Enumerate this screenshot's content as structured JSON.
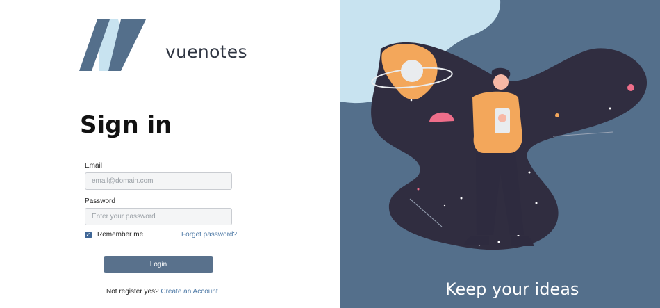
{
  "brand": {
    "name": "vuenotes",
    "logo_icon": "vuenotes-logo-icon"
  },
  "signin": {
    "title": "Sign in",
    "email_label": "Email",
    "email_placeholder": "email@domain.com",
    "email_value": "",
    "password_label": "Password",
    "password_placeholder": "Enter your password",
    "password_value": "",
    "remember_label": "Remember me",
    "remember_checked": true,
    "forgot_label": "Forget password?",
    "login_label": "Login",
    "register_prompt": "Not register yes?",
    "register_link": "Create an Account"
  },
  "hero": {
    "tagline": "Keep your ideas",
    "illustration_icon": "person-space-illustration"
  },
  "colors": {
    "accent": "#59718c",
    "link": "#4f7aa6",
    "panel_bg": "#546f8b",
    "light_blue": "#c8e3f0",
    "dark_swirl": "#302d40",
    "orange": "#f3a75b"
  }
}
